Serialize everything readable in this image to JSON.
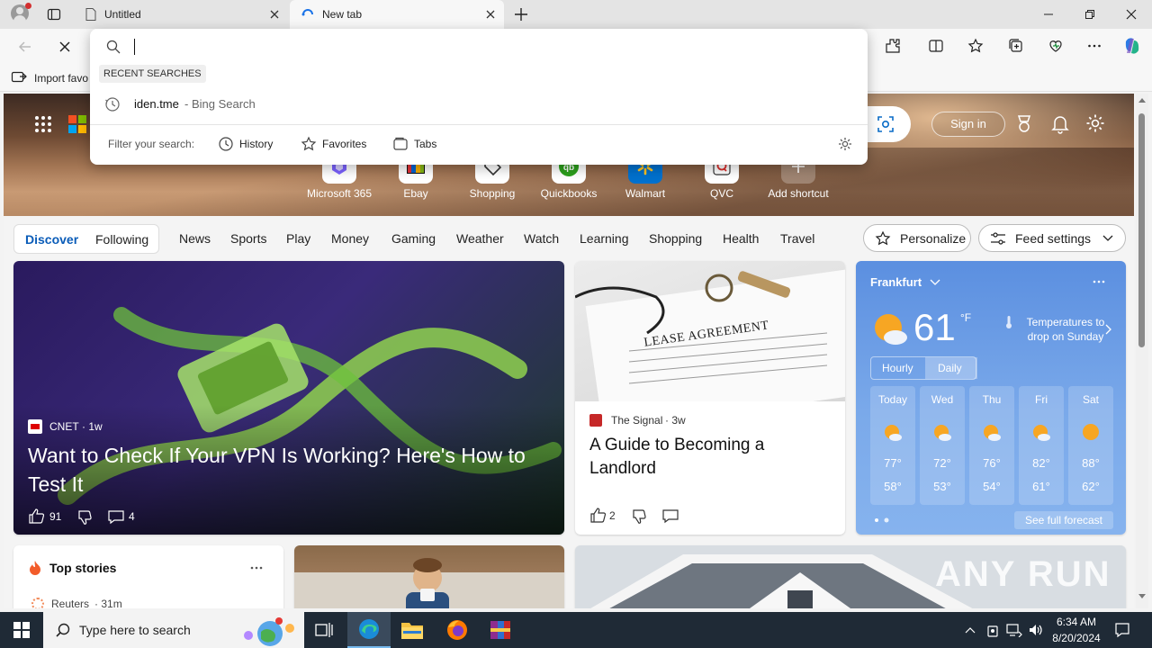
{
  "browser": {
    "tabs": [
      {
        "title": "Untitled"
      },
      {
        "title": "New tab"
      }
    ],
    "favorites_bar": {
      "import_label": "Import favo"
    }
  },
  "omnibox": {
    "value": "",
    "section_title": "RECENT SEARCHES",
    "recent": [
      {
        "query": "iden.tme",
        "suffix": " - Bing Search"
      }
    ],
    "filter_label": "Filter your search:",
    "filters": [
      {
        "label": "History"
      },
      {
        "label": "Favorites"
      },
      {
        "label": "Tabs"
      }
    ]
  },
  "header": {
    "sign_in": "Sign in"
  },
  "shortcuts": [
    {
      "label": "Microsoft 365"
    },
    {
      "label": "Ebay"
    },
    {
      "label": "Shopping"
    },
    {
      "label": "Quickbooks"
    },
    {
      "label": "Walmart"
    },
    {
      "label": "QVC"
    },
    {
      "label": "Add shortcut"
    }
  ],
  "nav": {
    "discover": "Discover",
    "following": "Following",
    "items": [
      "News",
      "Sports",
      "Play",
      "Money",
      "Gaming",
      "Weather",
      "Watch",
      "Learning",
      "Shopping",
      "Health",
      "Travel"
    ],
    "personalize": "Personalize",
    "feed_settings": "Feed settings"
  },
  "feed": {
    "main": {
      "source": "CNET",
      "age": "1w",
      "title": "Want to Check If Your VPN Is Working? Here's How to Test It",
      "likes": "91",
      "comments": "4"
    },
    "second": {
      "image_text": "LEASE AGREEMENT",
      "source": "The Signal",
      "age": "3w",
      "title": "A Guide to Becoming a Landlord",
      "likes": "2"
    },
    "top_stories": {
      "title": "Top stories",
      "first_source": "Reuters",
      "first_age": "31m"
    }
  },
  "weather": {
    "city": "Frankfurt",
    "temp": "61",
    "unit": "°F",
    "note": "Temperatures to drop on Sunday",
    "tabs": [
      "Hourly",
      "Daily"
    ],
    "days": [
      {
        "day": "Today",
        "hi": "77°",
        "lo": "58°"
      },
      {
        "day": "Wed",
        "hi": "72°",
        "lo": "53°"
      },
      {
        "day": "Thu",
        "hi": "76°",
        "lo": "54°"
      },
      {
        "day": "Fri",
        "hi": "82°",
        "lo": "61°"
      },
      {
        "day": "Sat",
        "hi": "88°",
        "lo": "62°"
      }
    ],
    "forecast_link": "See full forecast"
  },
  "watermark": "ANY RUN",
  "taskbar": {
    "search_placeholder": "Type here to search",
    "time": "6:34 AM",
    "date": "8/20/2024"
  }
}
